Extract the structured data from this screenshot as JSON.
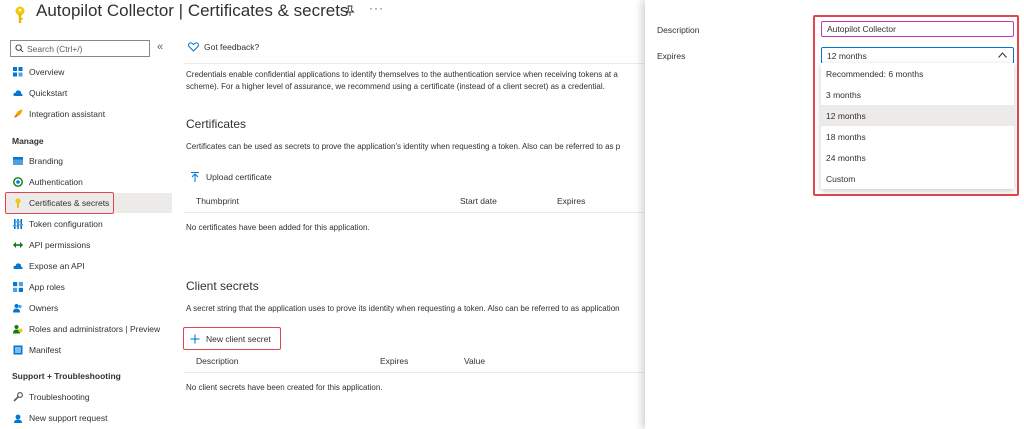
{
  "header": {
    "title": "Autopilot Collector | Certificates & secrets",
    "more": "···"
  },
  "sidebar": {
    "search_placeholder": "Search (Ctrl+/)",
    "collapse": "«",
    "items_top": [
      {
        "label": "Overview",
        "icon": "grid-icon"
      },
      {
        "label": "Quickstart",
        "icon": "cloud-icon"
      },
      {
        "label": "Integration assistant",
        "icon": "rocket-icon"
      }
    ],
    "manage_label": "Manage",
    "items_manage": [
      {
        "label": "Branding",
        "icon": "branding-icon"
      },
      {
        "label": "Authentication",
        "icon": "authentication-icon"
      },
      {
        "label": "Certificates & secrets",
        "icon": "key-icon"
      },
      {
        "label": "Token configuration",
        "icon": "token-icon"
      },
      {
        "label": "API permissions",
        "icon": "permissions-icon"
      },
      {
        "label": "Expose an API",
        "icon": "cloud-icon"
      },
      {
        "label": "App roles",
        "icon": "app-roles-icon"
      },
      {
        "label": "Owners",
        "icon": "owners-icon"
      },
      {
        "label": "Roles and administrators | Preview",
        "icon": "roles-icon"
      },
      {
        "label": "Manifest",
        "icon": "manifest-icon"
      }
    ],
    "support_label": "Support + Troubleshooting",
    "items_support": [
      {
        "label": "Troubleshooting",
        "icon": "wrench-icon"
      },
      {
        "label": "New support request",
        "icon": "support-icon"
      }
    ]
  },
  "main": {
    "feedback": "Got feedback?",
    "intro_line1": "Credentials enable confidential applications to identify themselves to the authentication service when receiving tokens at a",
    "intro_line2": "scheme). For a higher level of assurance, we recommend using a certificate (instead of a client secret) as a credential.",
    "certificates": {
      "title": "Certificates",
      "description": "Certificates can be used as secrets to prove the application's identity when requesting a token. Also can be referred to as p",
      "upload_label": "Upload certificate",
      "columns": [
        "Thumbprint",
        "Start date",
        "Expires"
      ],
      "empty": "No certificates have been added for this application."
    },
    "client_secrets": {
      "title": "Client secrets",
      "description": "A secret string that the application uses to prove its identity when requesting a token. Also can be referred to as application",
      "new_label": "New client secret",
      "columns": [
        "Description",
        "Expires",
        "Value"
      ],
      "empty": "No client secrets have been created for this application."
    }
  },
  "panel": {
    "description_label": "Description",
    "description_value": "Autopilot Collector",
    "expires_label": "Expires",
    "expires_value": "12 months",
    "options": [
      "Recommended: 6 months",
      "3 months",
      "12 months",
      "18 months",
      "24 months",
      "Custom"
    ],
    "selected_index": 2
  },
  "colors": {
    "highlight": "#e0474c",
    "accent": "#0078d4",
    "focus": "#c239b3",
    "key": "#f2c811"
  }
}
